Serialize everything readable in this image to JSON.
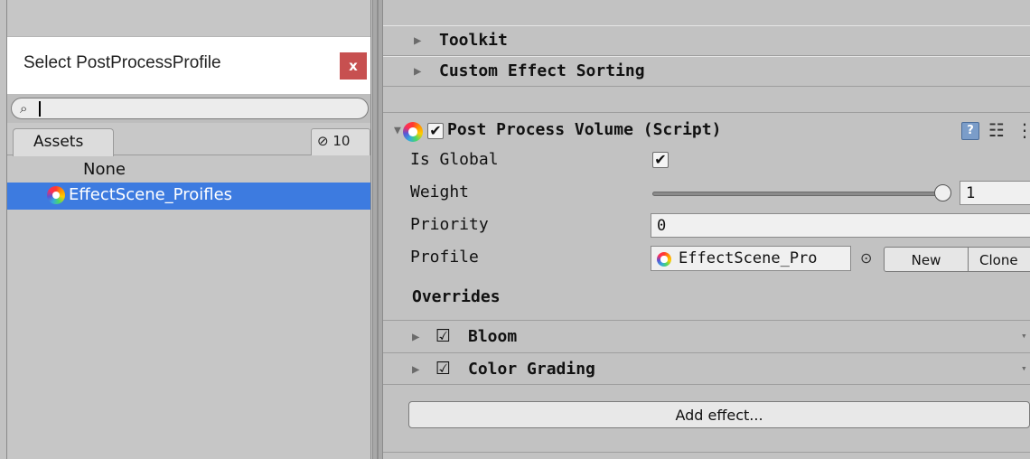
{
  "picker": {
    "title": "Select PostProcessProfile",
    "close_label": "x",
    "search": {
      "value": "",
      "placeholder": ""
    },
    "tab_assets": "Assets",
    "hidden_count": "10",
    "items": [
      {
        "label": "None"
      },
      {
        "label": "EffectScene_Proifles",
        "selected": true
      }
    ]
  },
  "inspector": {
    "sections": [
      {
        "label": "Toolkit"
      },
      {
        "label": "Custom Effect Sorting"
      }
    ],
    "component": {
      "title": "Post Process Volume (Script)",
      "enabled": true,
      "properties": {
        "is_global_label": "Is Global",
        "is_global": true,
        "weight_label": "Weight",
        "weight_value": "1",
        "priority_label": "Priority",
        "priority_value": "0",
        "profile_label": "Profile",
        "profile_value": "EffectScene_Pro"
      },
      "buttons": {
        "new": "New",
        "clone": "Clone"
      },
      "overrides_label": "Overrides",
      "effects": [
        {
          "label": "Bloom",
          "enabled": true
        },
        {
          "label": "Color Grading",
          "enabled": true
        }
      ],
      "add_effect": "Add effect..."
    }
  },
  "colors": {
    "selection": "#3d7be0",
    "panel_bg": "#c2c2c2",
    "close_button": "#c75050"
  },
  "icons": {
    "search": "search-icon",
    "hidden": "eye-slash-icon",
    "profile": "post-process-icon",
    "help": "help-icon",
    "settings": "preset-icon",
    "gear": "gear-icon"
  }
}
